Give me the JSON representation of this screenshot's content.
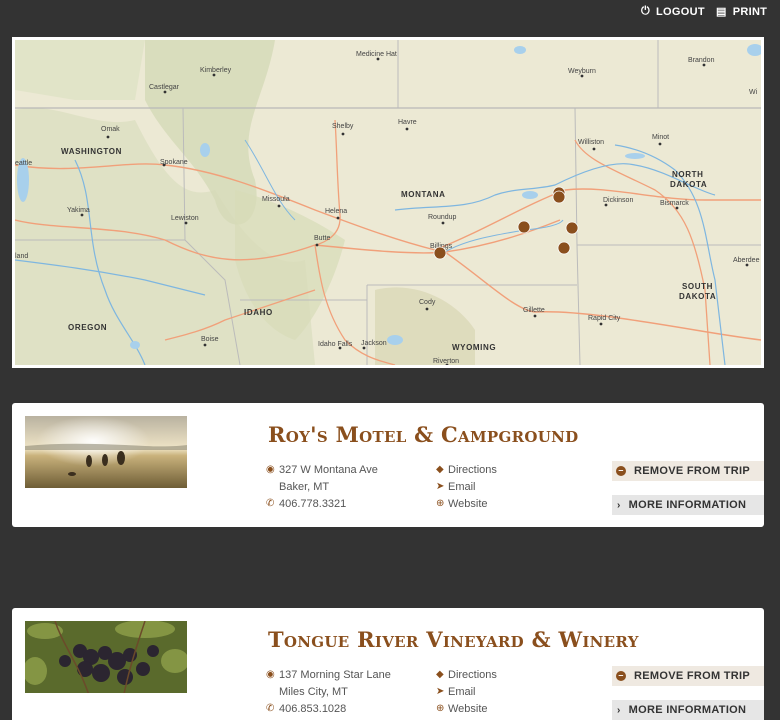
{
  "header": {
    "logout_label": "LOGOUT",
    "print_label": "PRINT",
    "logout_icon": "logout-icon",
    "print_icon": "printer-icon"
  },
  "map": {
    "labels": {
      "washington": "WASHINGTON",
      "montana": "MONTANA",
      "north_dakota": "NORTH DAKOTA",
      "north": "NORTH",
      "dakota": "DAKOTA",
      "south": "SOUTH",
      "sdakota": "DAKOTA",
      "idaho": "IDAHO",
      "oregon": "OREGON",
      "wyoming": "WYOMING",
      "medicine_hat": "Medicine Hat",
      "kimberley": "Kimberley",
      "castlegar": "Castlegar",
      "weyburn": "Weyburn",
      "brandon": "Brandon",
      "wi": "Wi",
      "omak": "Omak",
      "shelby": "Shelby",
      "havre": "Havre",
      "williston": "Williston",
      "minot": "Minot",
      "seattle": "eattle",
      "spokane": "Spokane",
      "dickinson": "Dickinson",
      "bismarck": "Bismarck",
      "yakima": "Yakima",
      "lewiston": "Lewiston",
      "missoula": "Missoula",
      "helena": "Helena",
      "roundup": "Roundup",
      "butte": "Butte",
      "billings": "Billings",
      "aberdeen": "Aberdee",
      "land": "land",
      "cody": "Cody",
      "gillette": "Gillette",
      "rapid_city": "Rapid City",
      "boise": "Boise",
      "idaho_falls": "Idaho Falls",
      "jackson": "Jackson",
      "riverton": "Riverton"
    },
    "marker_color": "#8a4f1d"
  },
  "listings": [
    {
      "title": "Roy's Motel & Campground",
      "address_line1": "327 W Montana Ave",
      "address_line2": "Baker, MT",
      "phone": "406.778.3321",
      "directions_label": "Directions",
      "email_label": "Email",
      "website_label": "Website",
      "remove_label": "REMOVE FROM TRIP",
      "more_label": "MORE INFORMATION"
    },
    {
      "title": "Tongue River Vineyard & Winery",
      "address_line1": "137 Morning Star Lane",
      "address_line2": "Miles City, MT",
      "phone": "406.853.1028",
      "directions_label": "Directions",
      "email_label": "Email",
      "website_label": "Website",
      "remove_label": "REMOVE FROM TRIP",
      "more_label": "MORE INFORMATION"
    }
  ],
  "colors": {
    "accent": "#8a4f1d",
    "page_bg": "#333333",
    "card_bg": "#ffffff"
  }
}
